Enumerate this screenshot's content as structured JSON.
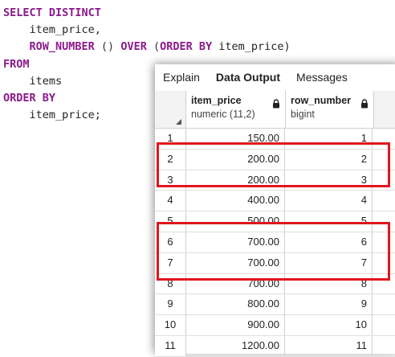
{
  "sql": {
    "select_kw": "SELECT DISTINCT",
    "line2_id": "item_price,",
    "line3_fn": "ROW_NUMBER",
    "line3_paren": " () ",
    "line3_over": "OVER",
    "line3_open": " (",
    "line3_orderby": "ORDER BY",
    "line3_id": " item_price)",
    "from_kw": "FROM",
    "table": "items",
    "order_kw": "ORDER BY",
    "order_id": "item_price;"
  },
  "tabs": [
    "Explain",
    "Data Output",
    "Messages"
  ],
  "active_tab": "Data Output",
  "columns": [
    {
      "name": "item_price",
      "type": "numeric (11,2)"
    },
    {
      "name": "row_number",
      "type": "bigint"
    }
  ],
  "rows": [
    {
      "n": "1",
      "item_price": "150.00",
      "row_number": "1"
    },
    {
      "n": "2",
      "item_price": "200.00",
      "row_number": "2"
    },
    {
      "n": "3",
      "item_price": "200.00",
      "row_number": "3"
    },
    {
      "n": "4",
      "item_price": "400.00",
      "row_number": "4"
    },
    {
      "n": "5",
      "item_price": "500.00",
      "row_number": "5"
    },
    {
      "n": "6",
      "item_price": "700.00",
      "row_number": "6"
    },
    {
      "n": "7",
      "item_price": "700.00",
      "row_number": "7"
    },
    {
      "n": "8",
      "item_price": "700.00",
      "row_number": "8"
    },
    {
      "n": "9",
      "item_price": "800.00",
      "row_number": "9"
    },
    {
      "n": "10",
      "item_price": "900.00",
      "row_number": "10"
    },
    {
      "n": "11",
      "item_price": "1200.00",
      "row_number": "11"
    }
  ],
  "highlight_color": "#e0161f",
  "highlighted_row_groups": [
    [
      "2",
      "3"
    ],
    [
      "6",
      "7",
      "8"
    ]
  ]
}
